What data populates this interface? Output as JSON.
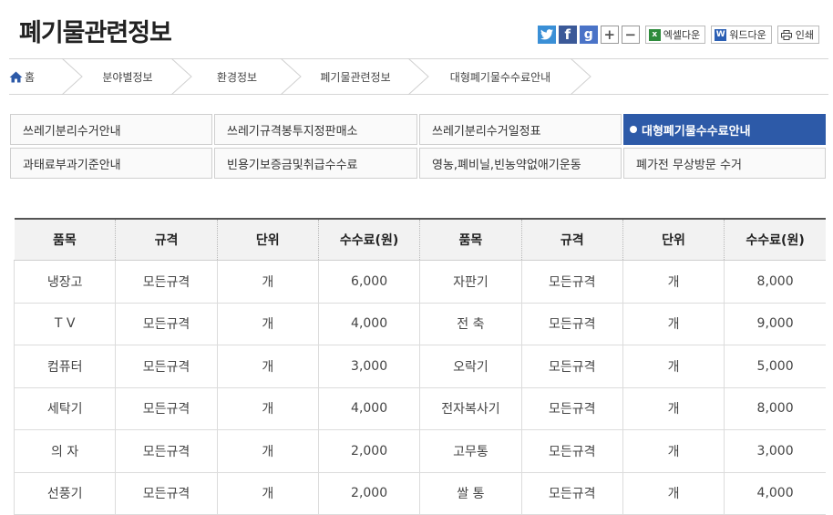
{
  "page": {
    "title": "폐기물관련정보"
  },
  "tools": {
    "share": [
      "twitter-icon",
      "facebook-icon",
      "google-plus-icon"
    ],
    "excel_label": "엑셀다운",
    "word_label": "워드다운",
    "print_label": "인쇄",
    "colors": {
      "twitter": "#3a8fd6",
      "facebook": "#3b5998",
      "google": "#4a73c7"
    }
  },
  "breadcrumb": {
    "home": "홈",
    "items": [
      "분야별정보",
      "환경정보",
      "폐기물관련정보",
      "대형폐기물수수료안내"
    ]
  },
  "tabs": [
    {
      "label": "쓰레기분리수거안내",
      "active": false
    },
    {
      "label": "쓰레기규격봉투지정판매소",
      "active": false
    },
    {
      "label": "쓰레기분리수거일정표",
      "active": false
    },
    {
      "label": "대형폐기물수수료안내",
      "active": true
    },
    {
      "label": "과태료부과기준안내",
      "active": false
    },
    {
      "label": "빈용기보증금및취급수수료",
      "active": false
    },
    {
      "label": "영농,폐비닐,빈농약없애기운동",
      "active": false
    },
    {
      "label": "폐가전 무상방문 수거",
      "active": false
    }
  ],
  "accent_color": "#2d5aa8",
  "fees_table": {
    "headers": [
      "품목",
      "규격",
      "단위",
      "수수료(원)",
      "품목",
      "규격",
      "단위",
      "수수료(원)"
    ],
    "rows": [
      [
        "냉장고",
        "모든규격",
        "개",
        "6,000",
        "자판기",
        "모든규격",
        "개",
        "8,000"
      ],
      [
        "T V",
        "모든규격",
        "개",
        "4,000",
        "전 축",
        "모든규격",
        "개",
        "9,000"
      ],
      [
        "컴퓨터",
        "모든규격",
        "개",
        "3,000",
        "오락기",
        "모든규격",
        "개",
        "5,000"
      ],
      [
        "세탁기",
        "모든규격",
        "개",
        "4,000",
        "전자복사기",
        "모든규격",
        "개",
        "8,000"
      ],
      [
        "의 자",
        "모든규격",
        "개",
        "2,000",
        "고무통",
        "모든규격",
        "개",
        "3,000"
      ],
      [
        "선풍기",
        "모든규격",
        "개",
        "2,000",
        "쌀 통",
        "모든규격",
        "개",
        "4,000"
      ]
    ]
  }
}
